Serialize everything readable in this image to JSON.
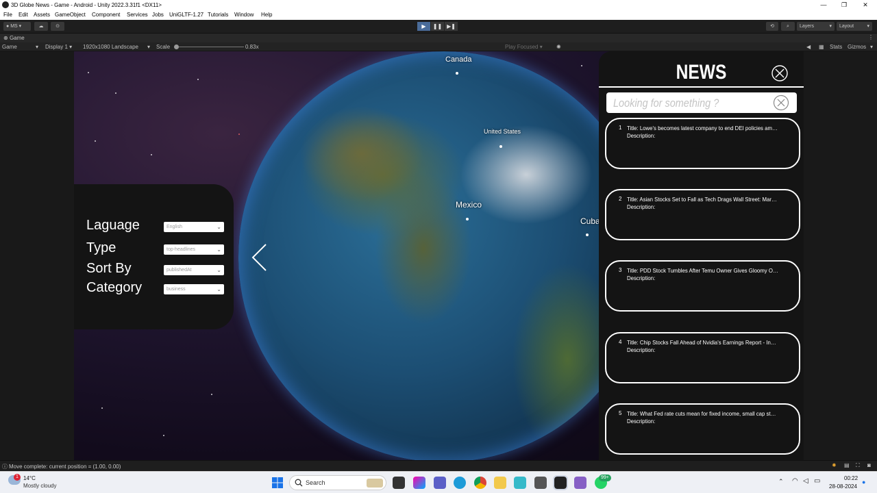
{
  "window": {
    "title": "3D Globe News - Game - Android - Unity 2022.3.31f1 <DX11>",
    "controls": [
      "—",
      "❐",
      "✕"
    ]
  },
  "menubar": [
    "File",
    "Edit",
    "Assets",
    "GameObject",
    "Component",
    "Services",
    "Jobs",
    "UniGLTF-1.27",
    "Tutorials",
    "Window",
    "Help"
  ],
  "toolbar": {
    "account": "MS",
    "layers": "Layers",
    "layout": "Layout"
  },
  "gametab": {
    "label": "Game"
  },
  "gamebar": {
    "mode": "Game",
    "display": "Display 1",
    "resolution": "1920x1080 Landscape",
    "scale_label": "Scale",
    "scale_value": "0.83x",
    "play_mode": "Play Focused",
    "stats": "Stats",
    "gizmos": "Gizmos"
  },
  "globe_labels": {
    "canada": "Canada",
    "usa": "United States",
    "mexico": "Mexico",
    "cuba": "Cuba"
  },
  "filters": {
    "language": {
      "label": "Laguage",
      "value": "English"
    },
    "type": {
      "label": "Type",
      "value": "top-headlines"
    },
    "sort": {
      "label": "Sort By",
      "value": "publishedAt"
    },
    "category": {
      "label": "Category",
      "value": "business"
    }
  },
  "news": {
    "heading": "NEWS",
    "search_placeholder": "Looking for something ?",
    "items": [
      {
        "num": "1",
        "title": "Title: Lowe's becomes latest company to end DEI policies amid growing ...",
        "desc": "Description:"
      },
      {
        "num": "2",
        "title": "Title: Asian Stocks Set to Fall as Tech Drags Wall Street: Markets Wrap - ...",
        "desc": "Description:"
      },
      {
        "num": "3",
        "title": "Title: PDD Stock Tumbles After Temu Owner Gives Gloomy Outlook - Th...",
        "desc": "Description:"
      },
      {
        "num": "4",
        "title": "Title: Chip Stocks Fall Ahead of Nvidia's Earnings Report - Investopedia",
        "desc": "Description:"
      },
      {
        "num": "5",
        "title": "Title: What Fed rate cuts mean for fixed income, small cap stocks - Yaho...",
        "desc": "Description:"
      }
    ]
  },
  "status": {
    "message": "Move complete: current position = (1.00, 0.00)"
  },
  "taskbar": {
    "weather_temp": "14°C",
    "weather_desc": "Mostly cloudy",
    "weather_badge": "1",
    "search_label": "Search",
    "notif_badge": "99+",
    "time": "00:22",
    "date": "28-08-2024"
  },
  "colors": {
    "panel": "#141414",
    "accent_play": "#4a6c9a",
    "glow": "#5096ff"
  }
}
